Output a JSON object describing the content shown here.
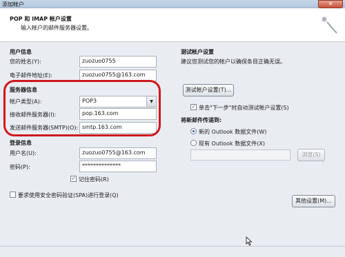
{
  "window": {
    "title": "添加帐户",
    "close_label": "✕"
  },
  "header": {
    "title": "POP 和 IMAP 帐户设置",
    "subtitle": "输入帐户的邮件服务器设置。"
  },
  "user_info": {
    "section": "用户信息",
    "name_label": "您的姓名(Y):",
    "name_value": "zuozuo0755",
    "email_label": "电子邮件地址(E):",
    "email_value": "zuozuo0755@163.com"
  },
  "server_info": {
    "section": "服务器信息",
    "type_label": "帐户类型(A):",
    "type_value": "POP3",
    "incoming_label": "接收邮件服务器(I):",
    "incoming_value": "pop.163.com",
    "outgoing_label": "发送邮件服务器(SMTP)(O):",
    "outgoing_value": "smtp.163.com"
  },
  "login_info": {
    "section": "登录信息",
    "username_label": "用户名(U):",
    "username_value": "zuozuo0755@163.com",
    "password_label": "密码(P):",
    "password_value": "**************",
    "remember_label": "记住密码(R)",
    "spa_label": "要求使用安全密码验证(SPA)进行登录(Q)"
  },
  "test_settings": {
    "section": "测试帐户设置",
    "desc": "建议您测试您的帐户以确保条目正确无误。",
    "test_button": "测试帐户设置(T)...",
    "auto_test_label": "单击\"下一步\"时自动测试帐户设置(S)"
  },
  "delivery": {
    "section": "将新邮件传递到:",
    "new_file_label": "新的 Outlook 数据文件(W)",
    "existing_file_label": "现有 Outlook 数据文件(X)",
    "browse_button": "浏览(S)"
  },
  "more_settings_button": "其他设置(M)..."
}
